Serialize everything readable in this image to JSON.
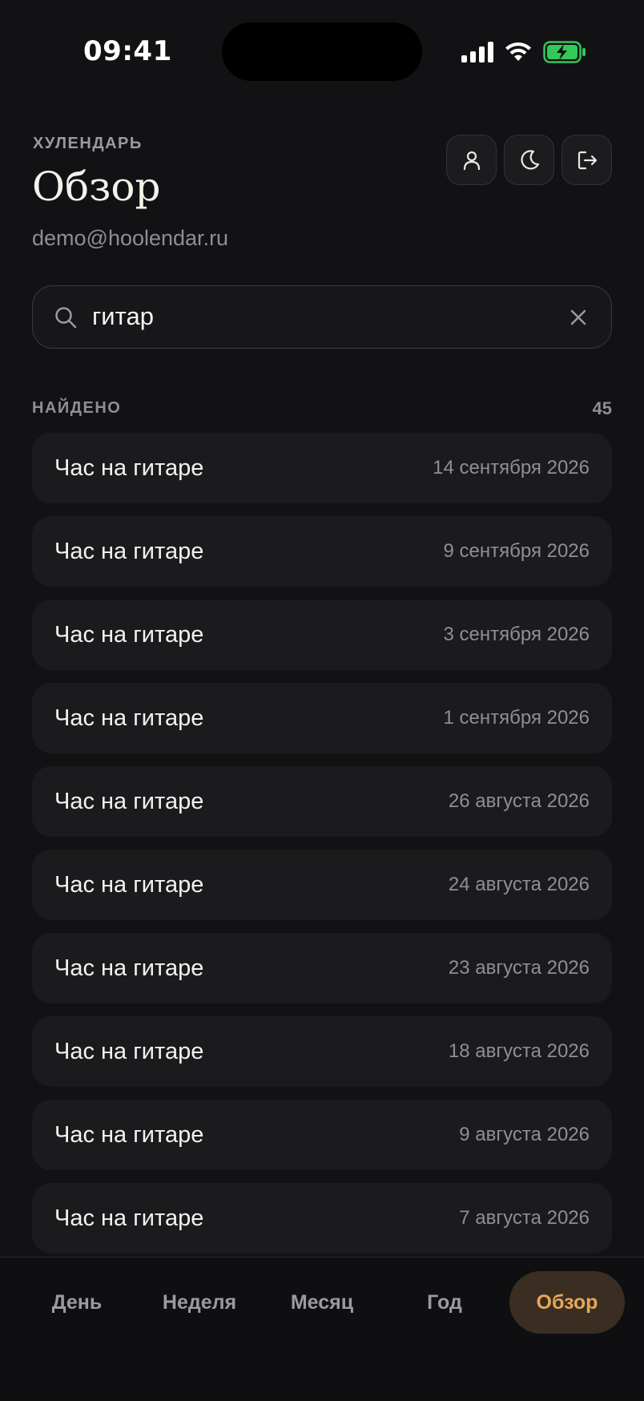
{
  "status_bar": {
    "time": "09:41"
  },
  "header": {
    "app_label": "ХУЛЕНДАРЬ",
    "title": "Обзор",
    "email": "demo@hoolendar.ru",
    "actions": [
      "profile-icon",
      "moon-icon",
      "logout-icon"
    ]
  },
  "search": {
    "value": "гитар",
    "placeholder": ""
  },
  "results": {
    "label": "НАЙДЕНО",
    "count": "45",
    "items": [
      {
        "title": "Час на гитаре",
        "date": "14 сентября 2026"
      },
      {
        "title": "Час на гитаре",
        "date": "9 сентября 2026"
      },
      {
        "title": "Час на гитаре",
        "date": "3 сентября 2026"
      },
      {
        "title": "Час на гитаре",
        "date": "1 сентября 2026"
      },
      {
        "title": "Час на гитаре",
        "date": "26 августа 2026"
      },
      {
        "title": "Час на гитаре",
        "date": "24 августа 2026"
      },
      {
        "title": "Час на гитаре",
        "date": "23 августа 2026"
      },
      {
        "title": "Час на гитаре",
        "date": "18 августа 2026"
      },
      {
        "title": "Час на гитаре",
        "date": "9 августа 2026"
      },
      {
        "title": "Час на гитаре",
        "date": "7 августа 2026"
      }
    ]
  },
  "nav": {
    "tabs": [
      {
        "label": "День",
        "active": false
      },
      {
        "label": "Неделя",
        "active": false
      },
      {
        "label": "Месяц",
        "active": false
      },
      {
        "label": "Год",
        "active": false
      },
      {
        "label": "Обзор",
        "active": true
      }
    ]
  },
  "colors": {
    "accent": "#e8a55a",
    "accent_bg": "#3a2e22",
    "battery": "#34c759"
  }
}
